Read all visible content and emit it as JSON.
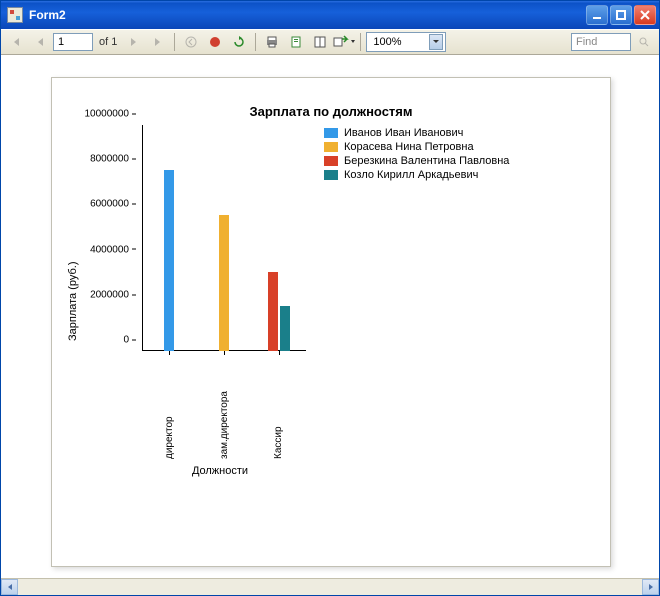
{
  "window": {
    "title": "Form2"
  },
  "toolbar": {
    "page_current": "1",
    "of_label": "of",
    "page_total": "1",
    "zoom": "100%",
    "find_placeholder": "Find"
  },
  "chart_data": {
    "type": "bar",
    "title": "Зарплата по должностям",
    "xlabel": "Должности",
    "ylabel": "Зарплата (руб.)",
    "ylim": [
      0,
      10000000
    ],
    "yticks": [
      0,
      2000000,
      4000000,
      6000000,
      8000000,
      10000000
    ],
    "categories": [
      "директор",
      "зам.директора",
      "Кассир"
    ],
    "series": [
      {
        "name": "Иванов Иван Иванович",
        "color": "#3399e8",
        "values": [
          8000000,
          null,
          null
        ]
      },
      {
        "name": "Корасева Нина Петровна",
        "color": "#f0b030",
        "values": [
          null,
          6000000,
          null
        ]
      },
      {
        "name": "Березкина Валентина Павловна",
        "color": "#d84028",
        "values": [
          null,
          null,
          3500000
        ]
      },
      {
        "name": "Козло Кирилл Аркадьевич",
        "color": "#1a7f8a",
        "values": [
          null,
          null,
          2000000
        ]
      }
    ]
  }
}
